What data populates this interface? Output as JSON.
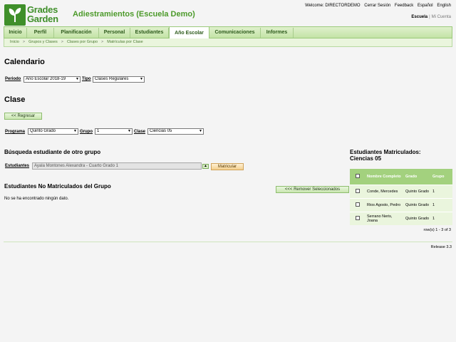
{
  "logo": {
    "line1": "Grades",
    "line2": "Garden"
  },
  "app_title": "Adiestramientos (Escuela Demo)",
  "topbar": {
    "welcome": "Welcome: DIRECTORDEMO",
    "logout": "Cerrar Sesión",
    "feedback": "Feedback",
    "lang_es": "Español",
    "lang_en": "English"
  },
  "context": {
    "school": "Escuela",
    "account": "Mi Cuenta"
  },
  "nav": [
    "Inicio",
    "Perfil",
    "Planificación",
    "Personal",
    "Estudiantes",
    "Año Escolar",
    "Comunicaciones",
    "Informes"
  ],
  "breadcrumb": [
    "Inicio",
    "Grupos y Clases",
    "Clases por Grupo",
    "Matrículas por Clase"
  ],
  "calendar": {
    "title": "Calendario",
    "periodo_label": "Periodo",
    "periodo_value": "Año Escolar 2018-19",
    "tipo_label": "Tipo",
    "tipo_value": "Clases Regulares"
  },
  "clase": {
    "title": "Clase",
    "back_button": "<< Regresar",
    "programa_label": "Programa",
    "programa_value": "Quinto Grado",
    "grupo_label": "Grupo",
    "grupo_value": "1",
    "clase_label": "Clase",
    "clase_value": "Ciencias 05"
  },
  "search": {
    "title": "Búsqueda estudiante de otro grupo",
    "estudiantes_label": "Estudiantes",
    "estudiantes_value": "Ayala Montones Alexandra - Cuarto Grado 1",
    "enroll_button": "Matricular"
  },
  "not_enrolled": {
    "title": "Estudiantes No Matriculados del Grupo",
    "empty": "No se ha encontrado ningún dato.",
    "remove_button": "<<< Remover Seleccionados"
  },
  "enrolled": {
    "title_line1": "Estudiantes Matriculados:",
    "title_line2": "Ciencias 05",
    "columns": {
      "name": "Nombre Completo",
      "grade": "Grado",
      "group": "Grupo"
    },
    "rows": [
      {
        "name": "Conde, Mercedes",
        "grade": "Quinto Grado",
        "group": "1"
      },
      {
        "name": "Rios Agosto, Pedro",
        "grade": "Quinto Grado",
        "group": "1"
      },
      {
        "name": "Serrano Neris, Joana",
        "grade": "Quinto Grado",
        "group": "1"
      }
    ],
    "pager": "row(s) 1 - 3 of 3"
  },
  "release": "Release 3.3",
  "colors": {
    "brand_green": "#3f8f2a",
    "header_green": "#a3d17e",
    "accent_orange": "#f3cf8e"
  }
}
